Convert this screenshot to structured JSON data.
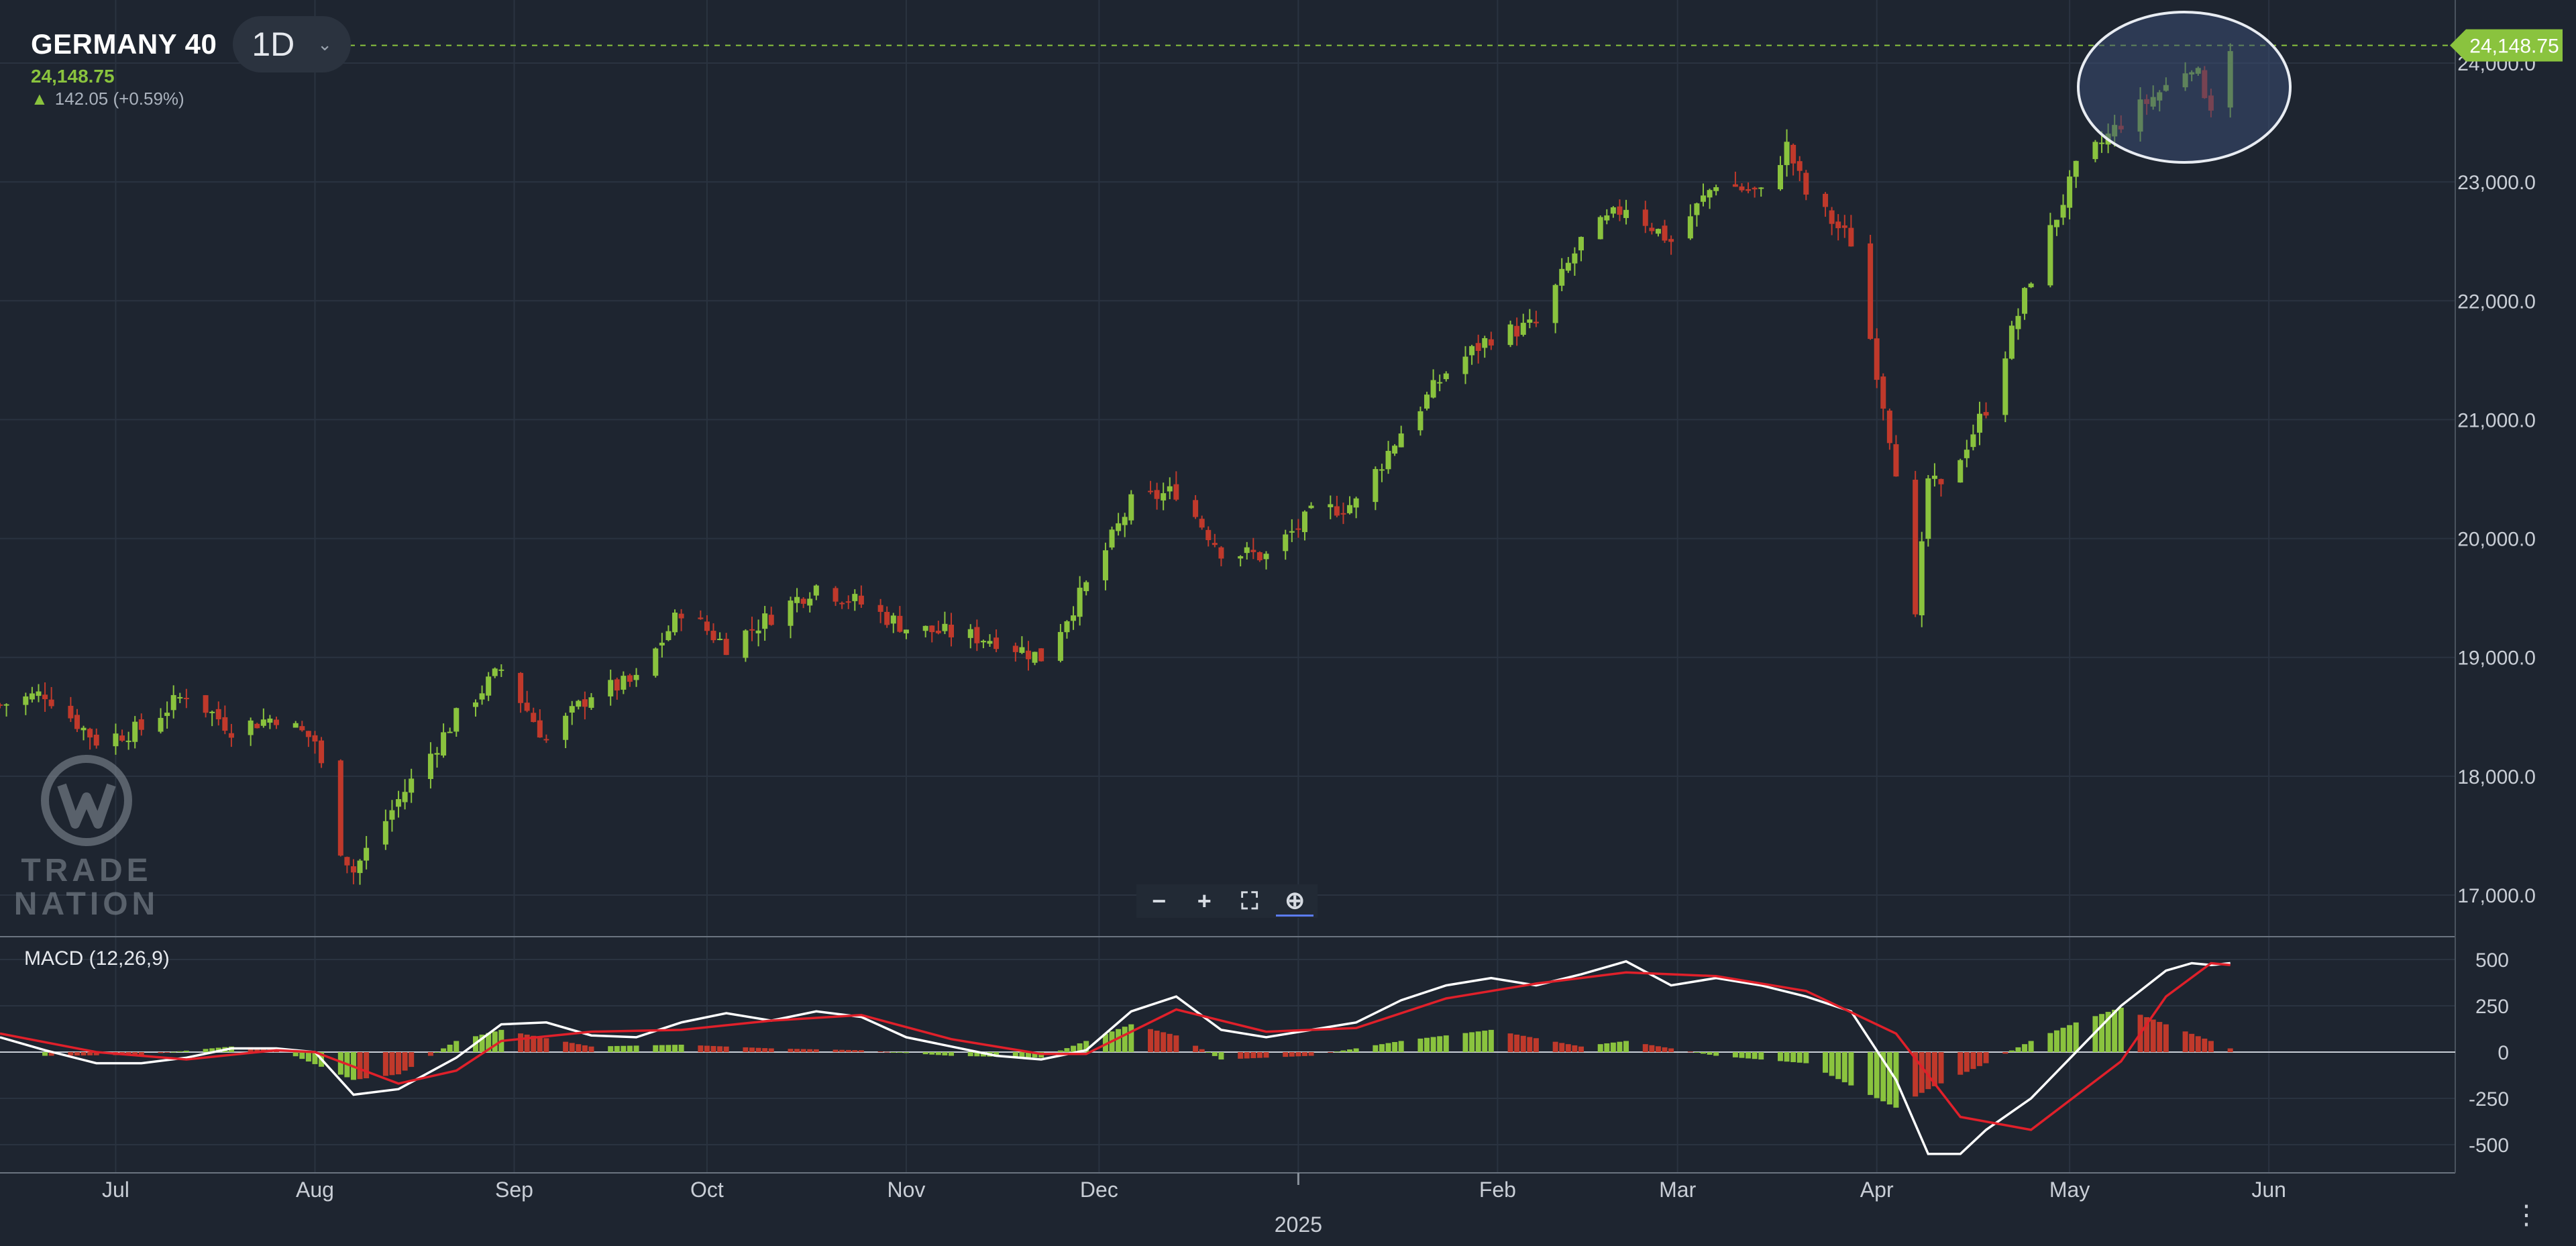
{
  "header": {
    "symbol": "GERMANY 40",
    "timeframe": "1D",
    "price": "24,148.75",
    "change": "142.05 (+0.59%)"
  },
  "logo": {
    "text": "TRADE NATION"
  },
  "macd": {
    "label": "MACD (12,26,9)"
  },
  "toolbar": {
    "zoom_out": "−",
    "zoom_in": "+",
    "fit": "⛶",
    "zoom_reset": "⊕"
  },
  "menu_label": "⋮",
  "colors": {
    "background": "#1e2530",
    "up": "#8ac33e",
    "down": "#c0392b",
    "macd_line": "#ffffff",
    "signal_line": "#e0202a",
    "price_tag": "#8ac33e",
    "highlight": "#3a4d73"
  },
  "chart_data": [
    {
      "type": "candlestick",
      "title": "GERMANY 40",
      "x_range": [
        "2024-06-13",
        "2025-06-30"
      ],
      "ylim": [
        16500,
        24300
      ],
      "y_ticks": [
        "17,000.0",
        "18,000.0",
        "19,000.0",
        "20,000.0",
        "21,000.0",
        "22,000.0",
        "23,000.0",
        "24,000.0"
      ],
      "y_tick_values": [
        17000,
        18000,
        19000,
        20000,
        21000,
        22000,
        23000,
        24000
      ],
      "x_ticks": [
        "Jul",
        "Aug",
        "Sep",
        "Oct",
        "Nov",
        "Dec",
        "2025",
        "Feb",
        "Mar",
        "Apr",
        "May",
        "Jun"
      ],
      "x_tick_dates": [
        "2024-07-01",
        "2024-08-01",
        "2024-09-01",
        "2024-10-01",
        "2024-11-01",
        "2024-12-01",
        "2025-01-01",
        "2025-02-01",
        "2025-03-01",
        "2025-04-01",
        "2025-05-01",
        "2025-06-01"
      ],
      "last_price": 24148.75,
      "last_price_label": "24,148.75",
      "highlight": "ellipse around recent highs (mid-May to late May 2025)",
      "grid": true,
      "close_path": [
        [
          "2024-06-13",
          18600
        ],
        [
          "2024-06-20",
          18700
        ],
        [
          "2024-06-28",
          18300
        ],
        [
          "2024-07-05",
          18400
        ],
        [
          "2024-07-12",
          18700
        ],
        [
          "2024-07-19",
          18400
        ],
        [
          "2024-07-26",
          18500
        ],
        [
          "2024-08-01",
          18300
        ],
        [
          "2024-08-05",
          17400
        ],
        [
          "2024-08-07",
          17200
        ],
        [
          "2024-08-14",
          17800
        ],
        [
          "2024-08-23",
          18500
        ],
        [
          "2024-08-30",
          18900
        ],
        [
          "2024-09-06",
          18300
        ],
        [
          "2024-09-13",
          18700
        ],
        [
          "2024-09-20",
          18800
        ],
        [
          "2024-09-27",
          19400
        ],
        [
          "2024-10-04",
          19100
        ],
        [
          "2024-10-11",
          19350
        ],
        [
          "2024-10-18",
          19600
        ],
        [
          "2024-10-25",
          19450
        ],
        [
          "2024-11-01",
          19250
        ],
        [
          "2024-11-08",
          19200
        ],
        [
          "2024-11-15",
          19150
        ],
        [
          "2024-11-22",
          19000
        ],
        [
          "2024-11-29",
          19600
        ],
        [
          "2024-12-06",
          20300
        ],
        [
          "2024-12-13",
          20400
        ],
        [
          "2024-12-20",
          19900
        ],
        [
          "2024-12-27",
          19850
        ],
        [
          "2025-01-03",
          20200
        ],
        [
          "2025-01-10",
          20300
        ],
        [
          "2025-01-17",
          20900
        ],
        [
          "2025-01-24",
          21400
        ],
        [
          "2025-01-31",
          21700
        ],
        [
          "2025-02-07",
          21800
        ],
        [
          "2025-02-14",
          22500
        ],
        [
          "2025-02-21",
          22800
        ],
        [
          "2025-02-28",
          22500
        ],
        [
          "2025-03-07",
          23000
        ],
        [
          "2025-03-14",
          22900
        ],
        [
          "2025-03-18",
          23300
        ],
        [
          "2025-03-21",
          22900
        ],
        [
          "2025-03-28",
          22500
        ],
        [
          "2025-04-04",
          20600
        ],
        [
          "2025-04-07",
          19300
        ],
        [
          "2025-04-09",
          20500
        ],
        [
          "2025-04-11",
          20400
        ],
        [
          "2025-04-18",
          21100
        ],
        [
          "2025-04-25",
          22200
        ],
        [
          "2025-05-02",
          23100
        ],
        [
          "2025-05-09",
          23500
        ],
        [
          "2025-05-16",
          23800
        ],
        [
          "2025-05-20",
          24000
        ],
        [
          "2025-05-23",
          23650
        ],
        [
          "2025-05-26",
          24148.75
        ]
      ]
    },
    {
      "type": "line",
      "title": "MACD (12,26,9)",
      "ylim": [
        -650,
        600
      ],
      "y_ticks": [
        "500",
        "250",
        "0",
        "-250",
        "-500"
      ],
      "y_tick_values": [
        500,
        250,
        0,
        -250,
        -500
      ],
      "series": [
        {
          "name": "MACD",
          "color": "#ffffff",
          "points": [
            [
              "2024-06-13",
              80
            ],
            [
              "2024-06-20",
              10
            ],
            [
              "2024-06-28",
              -60
            ],
            [
              "2024-07-05",
              -60
            ],
            [
              "2024-07-12",
              -30
            ],
            [
              "2024-07-19",
              20
            ],
            [
              "2024-07-26",
              20
            ],
            [
              "2024-08-01",
              0
            ],
            [
              "2024-08-07",
              -230
            ],
            [
              "2024-08-14",
              -200
            ],
            [
              "2024-08-23",
              -30
            ],
            [
              "2024-08-30",
              150
            ],
            [
              "2024-09-06",
              160
            ],
            [
              "2024-09-13",
              90
            ],
            [
              "2024-09-20",
              80
            ],
            [
              "2024-09-27",
              160
            ],
            [
              "2024-10-04",
              210
            ],
            [
              "2024-10-11",
              170
            ],
            [
              "2024-10-18",
              220
            ],
            [
              "2024-10-25",
              190
            ],
            [
              "2024-11-01",
              80
            ],
            [
              "2024-11-08",
              30
            ],
            [
              "2024-11-15",
              -20
            ],
            [
              "2024-11-22",
              -40
            ],
            [
              "2024-11-29",
              10
            ],
            [
              "2024-12-06",
              220
            ],
            [
              "2024-12-13",
              300
            ],
            [
              "2024-12-20",
              120
            ],
            [
              "2024-12-27",
              80
            ],
            [
              "2025-01-03",
              120
            ],
            [
              "2025-01-10",
              160
            ],
            [
              "2025-01-17",
              280
            ],
            [
              "2025-01-24",
              360
            ],
            [
              "2025-01-31",
              400
            ],
            [
              "2025-02-07",
              360
            ],
            [
              "2025-02-14",
              420
            ],
            [
              "2025-02-21",
              490
            ],
            [
              "2025-02-28",
              360
            ],
            [
              "2025-03-07",
              400
            ],
            [
              "2025-03-14",
              360
            ],
            [
              "2025-03-21",
              300
            ],
            [
              "2025-03-28",
              220
            ],
            [
              "2025-04-04",
              -150
            ],
            [
              "2025-04-09",
              -550
            ],
            [
              "2025-04-14",
              -550
            ],
            [
              "2025-04-18",
              -420
            ],
            [
              "2025-04-25",
              -250
            ],
            [
              "2025-05-02",
              0
            ],
            [
              "2025-05-09",
              250
            ],
            [
              "2025-05-16",
              440
            ],
            [
              "2025-05-20",
              480
            ],
            [
              "2025-05-23",
              470
            ],
            [
              "2025-05-26",
              480
            ]
          ]
        },
        {
          "name": "Signal",
          "color": "#e0202a",
          "points": [
            [
              "2024-06-13",
              100
            ],
            [
              "2024-06-28",
              0
            ],
            [
              "2024-07-12",
              -40
            ],
            [
              "2024-07-26",
              10
            ],
            [
              "2024-08-01",
              0
            ],
            [
              "2024-08-14",
              -170
            ],
            [
              "2024-08-23",
              -100
            ],
            [
              "2024-08-30",
              60
            ],
            [
              "2024-09-13",
              110
            ],
            [
              "2024-09-27",
              120
            ],
            [
              "2024-10-11",
              170
            ],
            [
              "2024-10-25",
              200
            ],
            [
              "2024-11-08",
              70
            ],
            [
              "2024-11-22",
              -10
            ],
            [
              "2024-11-29",
              -10
            ],
            [
              "2024-12-13",
              230
            ],
            [
              "2024-12-27",
              110
            ],
            [
              "2025-01-10",
              130
            ],
            [
              "2025-01-24",
              290
            ],
            [
              "2025-02-07",
              370
            ],
            [
              "2025-02-21",
              430
            ],
            [
              "2025-03-07",
              410
            ],
            [
              "2025-03-21",
              330
            ],
            [
              "2025-04-04",
              100
            ],
            [
              "2025-04-14",
              -350
            ],
            [
              "2025-04-25",
              -420
            ],
            [
              "2025-05-09",
              -50
            ],
            [
              "2025-05-16",
              300
            ],
            [
              "2025-05-23",
              480
            ],
            [
              "2025-05-26",
              470
            ]
          ]
        }
      ],
      "histogram": [
        [
          "2024-06-20",
          -20
        ],
        [
          "2024-07-05",
          -15
        ],
        [
          "2024-07-19",
          30
        ],
        [
          "2024-07-26",
          20
        ],
        [
          "2024-08-07",
          -150
        ],
        [
          "2024-08-14",
          -120
        ],
        [
          "2024-08-23",
          60
        ],
        [
          "2024-08-30",
          120
        ],
        [
          "2024-09-13",
          30
        ],
        [
          "2024-09-27",
          40
        ],
        [
          "2024-10-11",
          20
        ],
        [
          "2024-10-25",
          10
        ],
        [
          "2024-11-08",
          -20
        ],
        [
          "2024-11-22",
          -30
        ],
        [
          "2024-12-06",
          150
        ],
        [
          "2024-12-13",
          90
        ],
        [
          "2024-12-20",
          -40
        ],
        [
          "2025-01-03",
          -20
        ],
        [
          "2025-01-17",
          60
        ],
        [
          "2025-01-31",
          120
        ],
        [
          "2025-02-14",
          30
        ],
        [
          "2025-02-21",
          60
        ],
        [
          "2025-03-07",
          -20
        ],
        [
          "2025-03-21",
          -60
        ],
        [
          "2025-04-04",
          -300
        ],
        [
          "2025-04-09",
          -200
        ],
        [
          "2025-04-18",
          -60
        ],
        [
          "2025-04-25",
          60
        ],
        [
          "2025-05-02",
          160
        ],
        [
          "2025-05-09",
          240
        ],
        [
          "2025-05-16",
          150
        ],
        [
          "2025-05-23",
          60
        ],
        [
          "2025-05-26",
          20
        ]
      ]
    }
  ]
}
